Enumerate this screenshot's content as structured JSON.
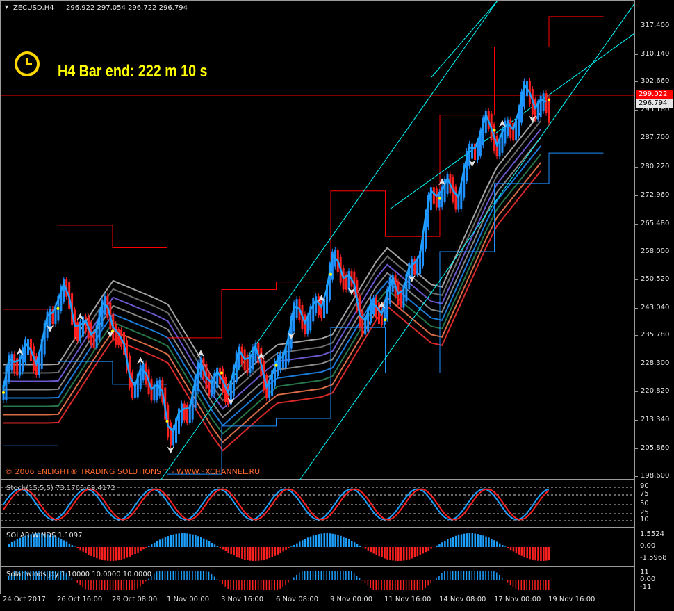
{
  "header": {
    "symbol": "ZECUSD,H4",
    "ohlc": "296.922 297.054 296.722 296.794"
  },
  "timer": {
    "icon": "clock-icon",
    "text": "H4 Bar end: 222 m 10 s",
    "color": "#ffff00"
  },
  "copyright": "© 2006 ENLIGHT® TRADING SOLUTIONS™ - WWW.FXCHANNEL.RU",
  "price_axis": [
    "317.400",
    "310.140",
    "302.660",
    "295.180",
    "287.700",
    "280.220",
    "272.960",
    "265.480",
    "258.000",
    "250.520",
    "243.040",
    "235.780",
    "228.300",
    "220.820",
    "213.340",
    "205.860",
    "198.600"
  ],
  "price_badges": {
    "red": "299.022",
    "current": "296.794"
  },
  "stoch": {
    "label": "Stoch(15,5,5) 73.1705 69.4172",
    "levels": [
      "90",
      "75",
      "50",
      "25",
      "10"
    ]
  },
  "solar_winds": {
    "label": "SOLAR WINDS 1.1097",
    "levels": [
      "1.5524",
      "0.00",
      "-1.5968"
    ]
  },
  "solar_joy": {
    "label": "Solar winds joy 1.10000 10.0000 10.0000",
    "levels": [
      "11",
      "0.00",
      "-11"
    ]
  },
  "x_axis": [
    "24 Oct 2017",
    "26 Oct 16:00",
    "29 Oct 08:00",
    "1 Nov 00:00",
    "3 Nov 16:00",
    "6 Nov 08:00",
    "9 Nov 00:00",
    "11 Nov 16:00",
    "14 Nov 08:00",
    "17 Nov 00:00",
    "19 Nov 16:00"
  ],
  "colors": {
    "bull": "#1e90ff",
    "bear": "#ff2020",
    "channel": "#00ffff",
    "envelope": "#ff0000",
    "support": "#1e90ff",
    "hull": "#ffff00"
  },
  "chart_data": {
    "type": "line",
    "title": "ZECUSD,H4",
    "ylim": [
      198.6,
      317.4
    ],
    "x": [
      "24 Oct 2017",
      "26 Oct 16:00",
      "29 Oct 08:00",
      "1 Nov 00:00",
      "3 Nov 16:00",
      "6 Nov 08:00",
      "9 Nov 00:00",
      "11 Nov 16:00",
      "14 Nov 08:00",
      "17 Nov 00:00",
      "19 Nov 16:00"
    ],
    "series": [
      {
        "values": [
          220.8,
          243.0,
          237.0,
          213.3,
          226.0,
          228.0,
          252.0,
          240.0,
          272.0,
          290.0,
          298.0
        ]
      }
    ]
  }
}
